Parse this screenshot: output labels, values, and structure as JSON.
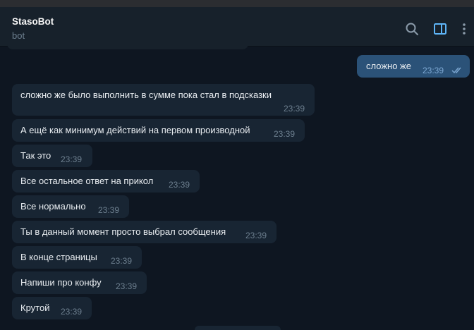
{
  "header": {
    "title": "StasoBot",
    "subtitle": "bot"
  },
  "outgoing": {
    "text": "сложно же",
    "time": "23:39"
  },
  "messages": [
    {
      "text": "сложно же было выполнить  в сумме пока стал в  подсказки",
      "time": "23:39"
    },
    {
      "text": "А ещё как минимум действий на первом производной",
      "time": "23:39"
    },
    {
      "text": "Так это",
      "time": "23:39"
    },
    {
      "text": "Все остальное ответ на прикол",
      "time": "23:39"
    },
    {
      "text": "Все нормально",
      "time": "23:39"
    },
    {
      "text": "Ты в данный момент просто выбрал сообщения",
      "time": "23:39"
    },
    {
      "text": "В конце страницы",
      "time": "23:39"
    },
    {
      "text": "Напиши про конфу",
      "time": "23:39"
    },
    {
      "text": "Крутой",
      "time": "23:39"
    }
  ],
  "icons": [
    "search-icon",
    "sidebar-toggle-icon",
    "more-options-icon",
    "double-check-icon"
  ],
  "colors": {
    "background": "#0e1621",
    "header": "#17212b",
    "incoming": "#182533",
    "outgoing": "#2b5278",
    "accent": "#5eb5f7"
  }
}
